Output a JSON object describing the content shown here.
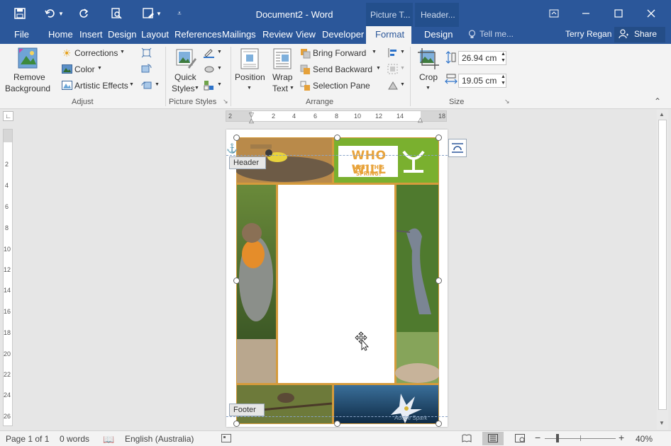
{
  "window": {
    "title": "Document2 - Word"
  },
  "contextual": {
    "picture_tools": "Picture T...",
    "header_tools": "Header..."
  },
  "tabs": [
    "File",
    "Home",
    "Insert",
    "Design",
    "Layout",
    "References",
    "Mailings",
    "Review",
    "View",
    "Developer",
    "Format",
    "Design"
  ],
  "tell_me": "Tell me...",
  "user": "Terry Regan",
  "share": "Share",
  "ribbon": {
    "remove_background": [
      "Remove",
      "Background"
    ],
    "corrections": "Corrections",
    "color": "Color",
    "artistic_effects": "Artistic Effects",
    "adjust_group": "Adjust",
    "quick_styles": [
      "Quick",
      "Styles"
    ],
    "picture_styles_group": "Picture Styles",
    "position": "Position",
    "wrap_text": [
      "Wrap",
      "Text"
    ],
    "bring_forward": "Bring Forward",
    "send_backward": "Send Backward",
    "selection_pane": "Selection Pane",
    "arrange_group": "Arrange",
    "crop": "Crop",
    "height": "26.94 cm",
    "width": "19.05 cm",
    "size_group": "Size"
  },
  "ruler_h": [
    "2",
    "2",
    "4",
    "6",
    "8",
    "10",
    "12",
    "14",
    "18"
  ],
  "ruler_v": [
    "2",
    "4",
    "6",
    "8",
    "10",
    "12",
    "14",
    "16",
    "18",
    "20",
    "22",
    "24",
    "26"
  ],
  "document": {
    "header_tag": "Header",
    "footer_tag": "Footer",
    "banner_line1": "WHO WILL",
    "banner_line2": "VISIT THIS SPRING?",
    "watermark": "Adobe Spark"
  },
  "status": {
    "page": "Page 1 of 1",
    "words": "0 words",
    "language": "English (Australia)",
    "zoom": "40%"
  },
  "colors": {
    "brand": "#2b579a",
    "green": "#7ab02f",
    "orange": "#e8a33b"
  }
}
